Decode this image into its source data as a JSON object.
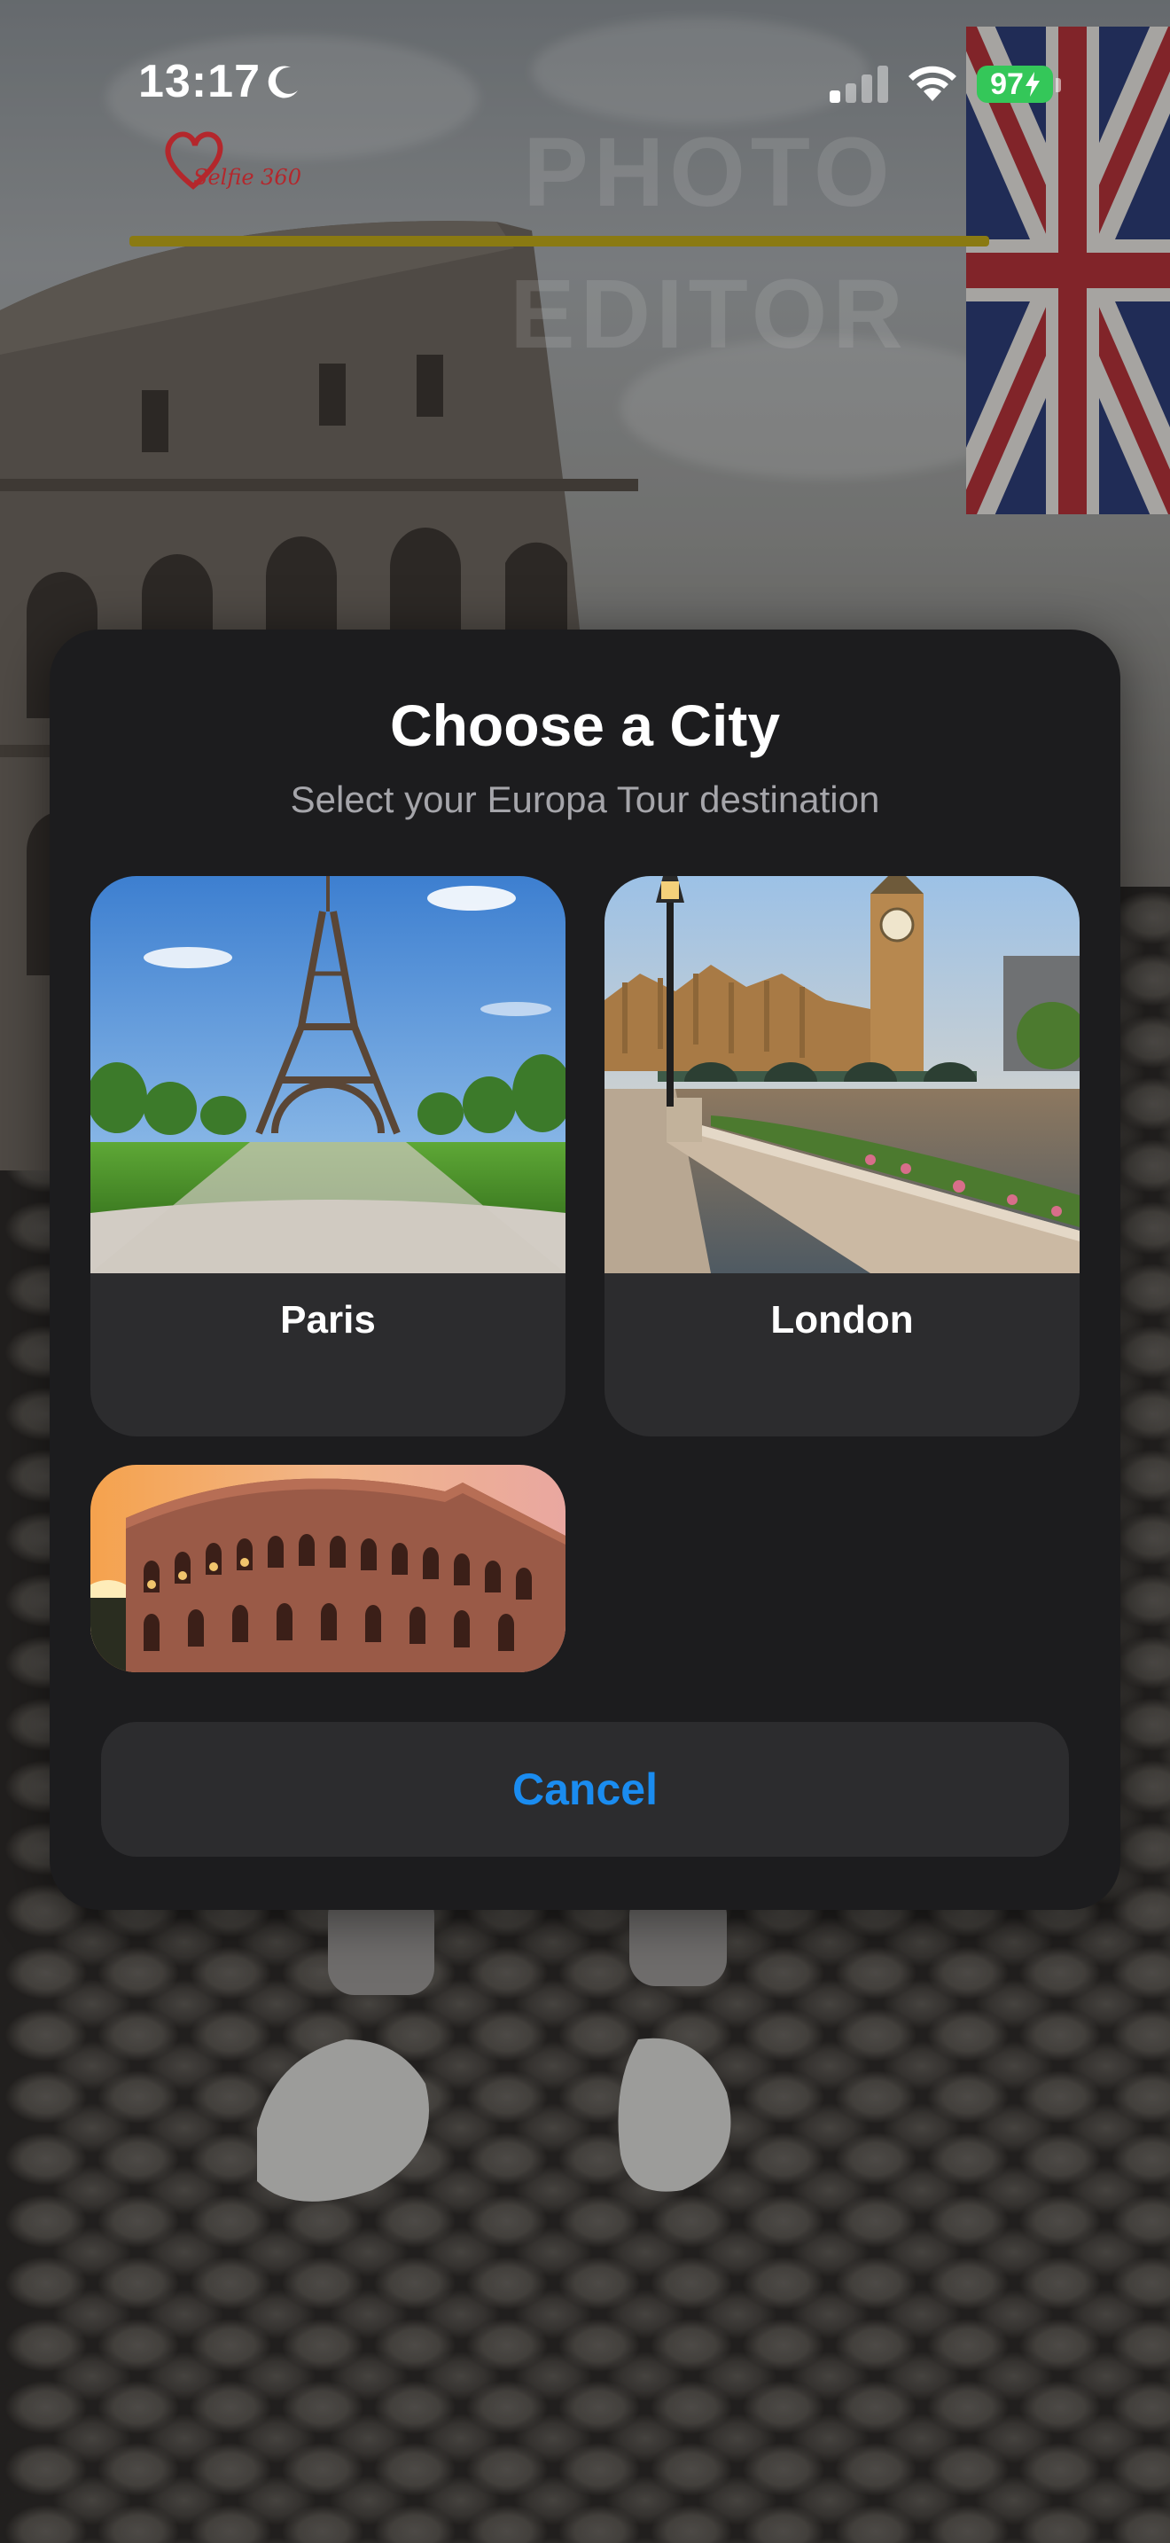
{
  "status_bar": {
    "time": "13:17",
    "battery": "97",
    "icons": [
      "moon-icon",
      "signal-icon",
      "wifi-icon",
      "battery-icon"
    ]
  },
  "background_header": {
    "logo_text": "Selfie 360",
    "title_line1": "PHOTO",
    "title_line2": "EDITOR",
    "accent_color": "#8a7a12"
  },
  "modal": {
    "title": "Choose a City",
    "subtitle": "Select your Europa Tour destination",
    "cities": [
      {
        "label": "Paris",
        "image": "eiffel-tower-photo"
      },
      {
        "label": "London",
        "image": "big-ben-photo"
      },
      {
        "label": "",
        "image": "colosseum-photo"
      }
    ],
    "cancel_label": "Cancel",
    "accent_color": "#1a8cf0"
  }
}
